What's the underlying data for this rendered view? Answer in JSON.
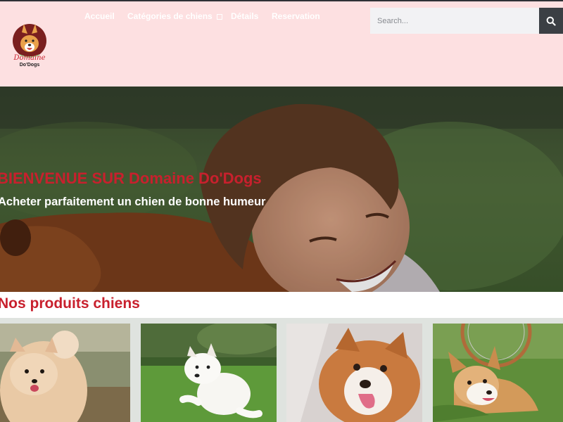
{
  "brand": {
    "logo_line1": "Domaine",
    "logo_line2": "Do'Dogs"
  },
  "nav": {
    "items": [
      {
        "label": "Accueil"
      },
      {
        "label": "Catégories de chiens"
      },
      {
        "label": "Détails"
      },
      {
        "label": "Reservation"
      }
    ]
  },
  "search": {
    "placeholder": "Search..."
  },
  "hero": {
    "title": "BIENVENUE SUR Domaine Do'Dogs",
    "subtitle": "Acheter parfaitement un chien de bonne humeur"
  },
  "products": {
    "title": "Nos produits chiens"
  },
  "colors": {
    "accent": "#c8202d",
    "header_bg": "#fde0e1",
    "search_button": "#3b3f44"
  }
}
